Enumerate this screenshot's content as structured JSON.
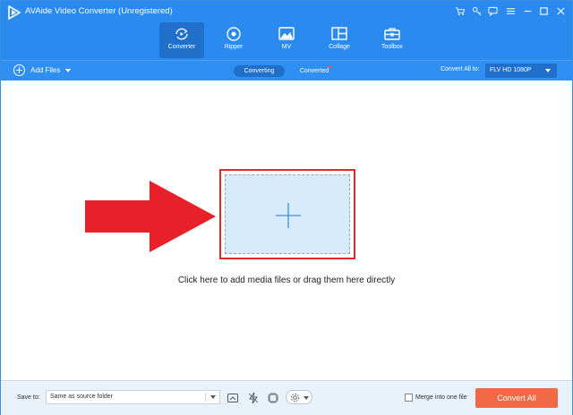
{
  "window": {
    "title": "AVAide Video Converter (Unregistered)",
    "controls": [
      "cart-icon",
      "key-icon",
      "feedback-icon",
      "menu-icon",
      "minimize-icon",
      "maximize-icon",
      "close-icon"
    ]
  },
  "nav": {
    "tabs": [
      {
        "label": "Converter",
        "icon": "converter-icon",
        "active": true
      },
      {
        "label": "Ripper",
        "icon": "ripper-icon",
        "active": false
      },
      {
        "label": "MV",
        "icon": "mv-icon",
        "active": false
      },
      {
        "label": "Collage",
        "icon": "collage-icon",
        "active": false
      },
      {
        "label": "Toolbox",
        "icon": "toolbox-icon",
        "active": false
      }
    ]
  },
  "toolbar": {
    "add_files_label": "Add Files",
    "segments": {
      "converting": "Converting",
      "converted": "Converted"
    },
    "convert_all_label": "Convert All to:",
    "format_value": "FLV HD 1080P"
  },
  "main": {
    "drop_hint": "Click here to add media files or drag them here directly"
  },
  "bottom": {
    "save_to_label": "Save to:",
    "save_path": "Same as source folder",
    "merge_label": "Merge into one file",
    "merge_checked": false,
    "convert_button": "Convert All"
  },
  "colors": {
    "brand_blue": "#2b8af0",
    "active_tab": "#1f6fcb",
    "convert_orange": "#f26a45",
    "highlight_red": "#e12b2b",
    "drop_zone_fill": "#d8ebfb"
  }
}
